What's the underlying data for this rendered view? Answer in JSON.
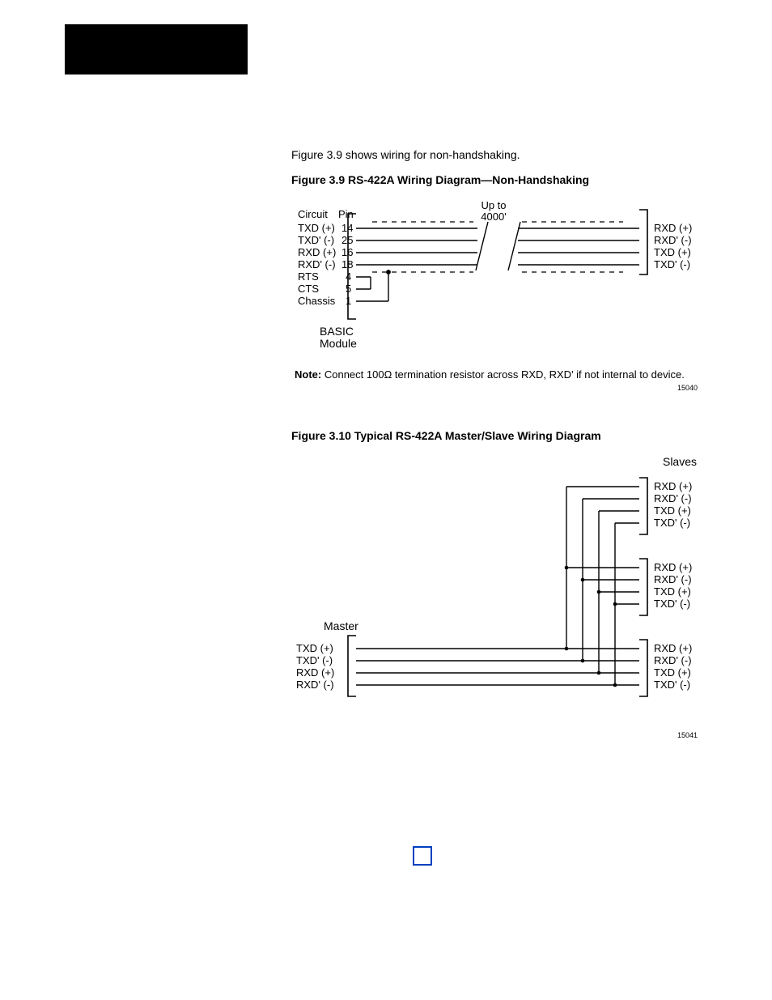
{
  "intro": "Figure 3.9 shows wiring for non-handshaking.",
  "caption1": "Figure 3.9 RS-422A Wiring Diagram—Non-Handshaking",
  "fig1": {
    "lenLabel1": "Up to",
    "lenLabel2": "4000'",
    "header1": "Circuit",
    "header2": "Pin",
    "left": [
      {
        "name": "TXD (+)",
        "pin": "14"
      },
      {
        "name": "TXD' (-)",
        "pin": "25"
      },
      {
        "name": "RXD (+)",
        "pin": "16"
      },
      {
        "name": "RXD' (-)",
        "pin": "18"
      },
      {
        "name": "RTS",
        "pin": "4"
      },
      {
        "name": "CTS",
        "pin": "5"
      },
      {
        "name": "Chassis",
        "pin": "1"
      }
    ],
    "right": [
      "RXD (+)",
      "RXD' (-)",
      "TXD (+)",
      "TXD' (-)"
    ],
    "moduleLabel1": "BASIC",
    "moduleLabel2": "Module",
    "noteLead": "Note:",
    "noteBody": "Connect 100Ω termination resistor across RXD, RXD' if not internal to device.",
    "id": "15040"
  },
  "caption2": "Figure 3.10 Typical RS-422A Master/Slave Wiring Diagram",
  "fig2": {
    "slavesLabel": "Slaves",
    "masterLabel": "Master",
    "slaveBlocks": [
      [
        "RXD (+)",
        "RXD' (-)",
        "TXD (+)",
        "TXD' (-)"
      ],
      [
        "RXD (+)",
        "RXD' (-)",
        "TXD (+)",
        "TXD' (-)"
      ],
      [
        "RXD (+)",
        "RXD' (-)",
        "TXD (+)",
        "TXD' (-)"
      ]
    ],
    "master": [
      "TXD (+)",
      "TXD' (-)",
      "RXD (+)",
      "RXD' (-)"
    ],
    "id": "15041"
  }
}
